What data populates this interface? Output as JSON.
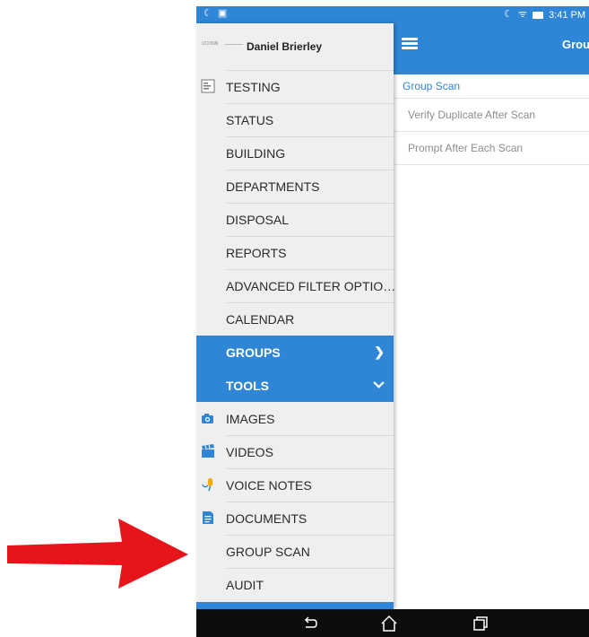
{
  "status_bar": {
    "time": "3:41 PM"
  },
  "app_bar": {
    "title": "Groups"
  },
  "content": {
    "section_header": "Group Scan",
    "options": [
      {
        "label": "Verify Duplicate After Scan"
      },
      {
        "label": "Prompt After Each Scan"
      }
    ]
  },
  "drawer": {
    "logo_text": "UCONN",
    "user_name": "Daniel Brierley",
    "items": [
      {
        "label": "TESTING",
        "icon": "testing-icon"
      },
      {
        "label": "STATUS"
      },
      {
        "label": "BUILDING"
      },
      {
        "label": "DEPARTMENTS"
      },
      {
        "label": "DISPOSAL"
      },
      {
        "label": "REPORTS"
      },
      {
        "label": "ADVANCED FILTER OPTIONS"
      },
      {
        "label": "CALENDAR"
      },
      {
        "label": "GROUPS",
        "icon": "chevron-right-icon"
      },
      {
        "label": "TOOLS",
        "icon": "chevron-down-icon"
      },
      {
        "label": "IMAGES",
        "icon": "camera-icon"
      },
      {
        "label": "VIDEOS",
        "icon": "clapperboard-icon"
      },
      {
        "label": "VOICE NOTES",
        "icon": "microphone-icon"
      },
      {
        "label": "DOCUMENTS",
        "icon": "document-icon"
      },
      {
        "label": "GROUP SCAN"
      },
      {
        "label": "AUDIT"
      }
    ]
  },
  "colors": {
    "accent": "#2f86d6",
    "arrow": "#e8141c",
    "drawer_bg": "#efefef",
    "nav_bar": "#0d0d0d"
  }
}
